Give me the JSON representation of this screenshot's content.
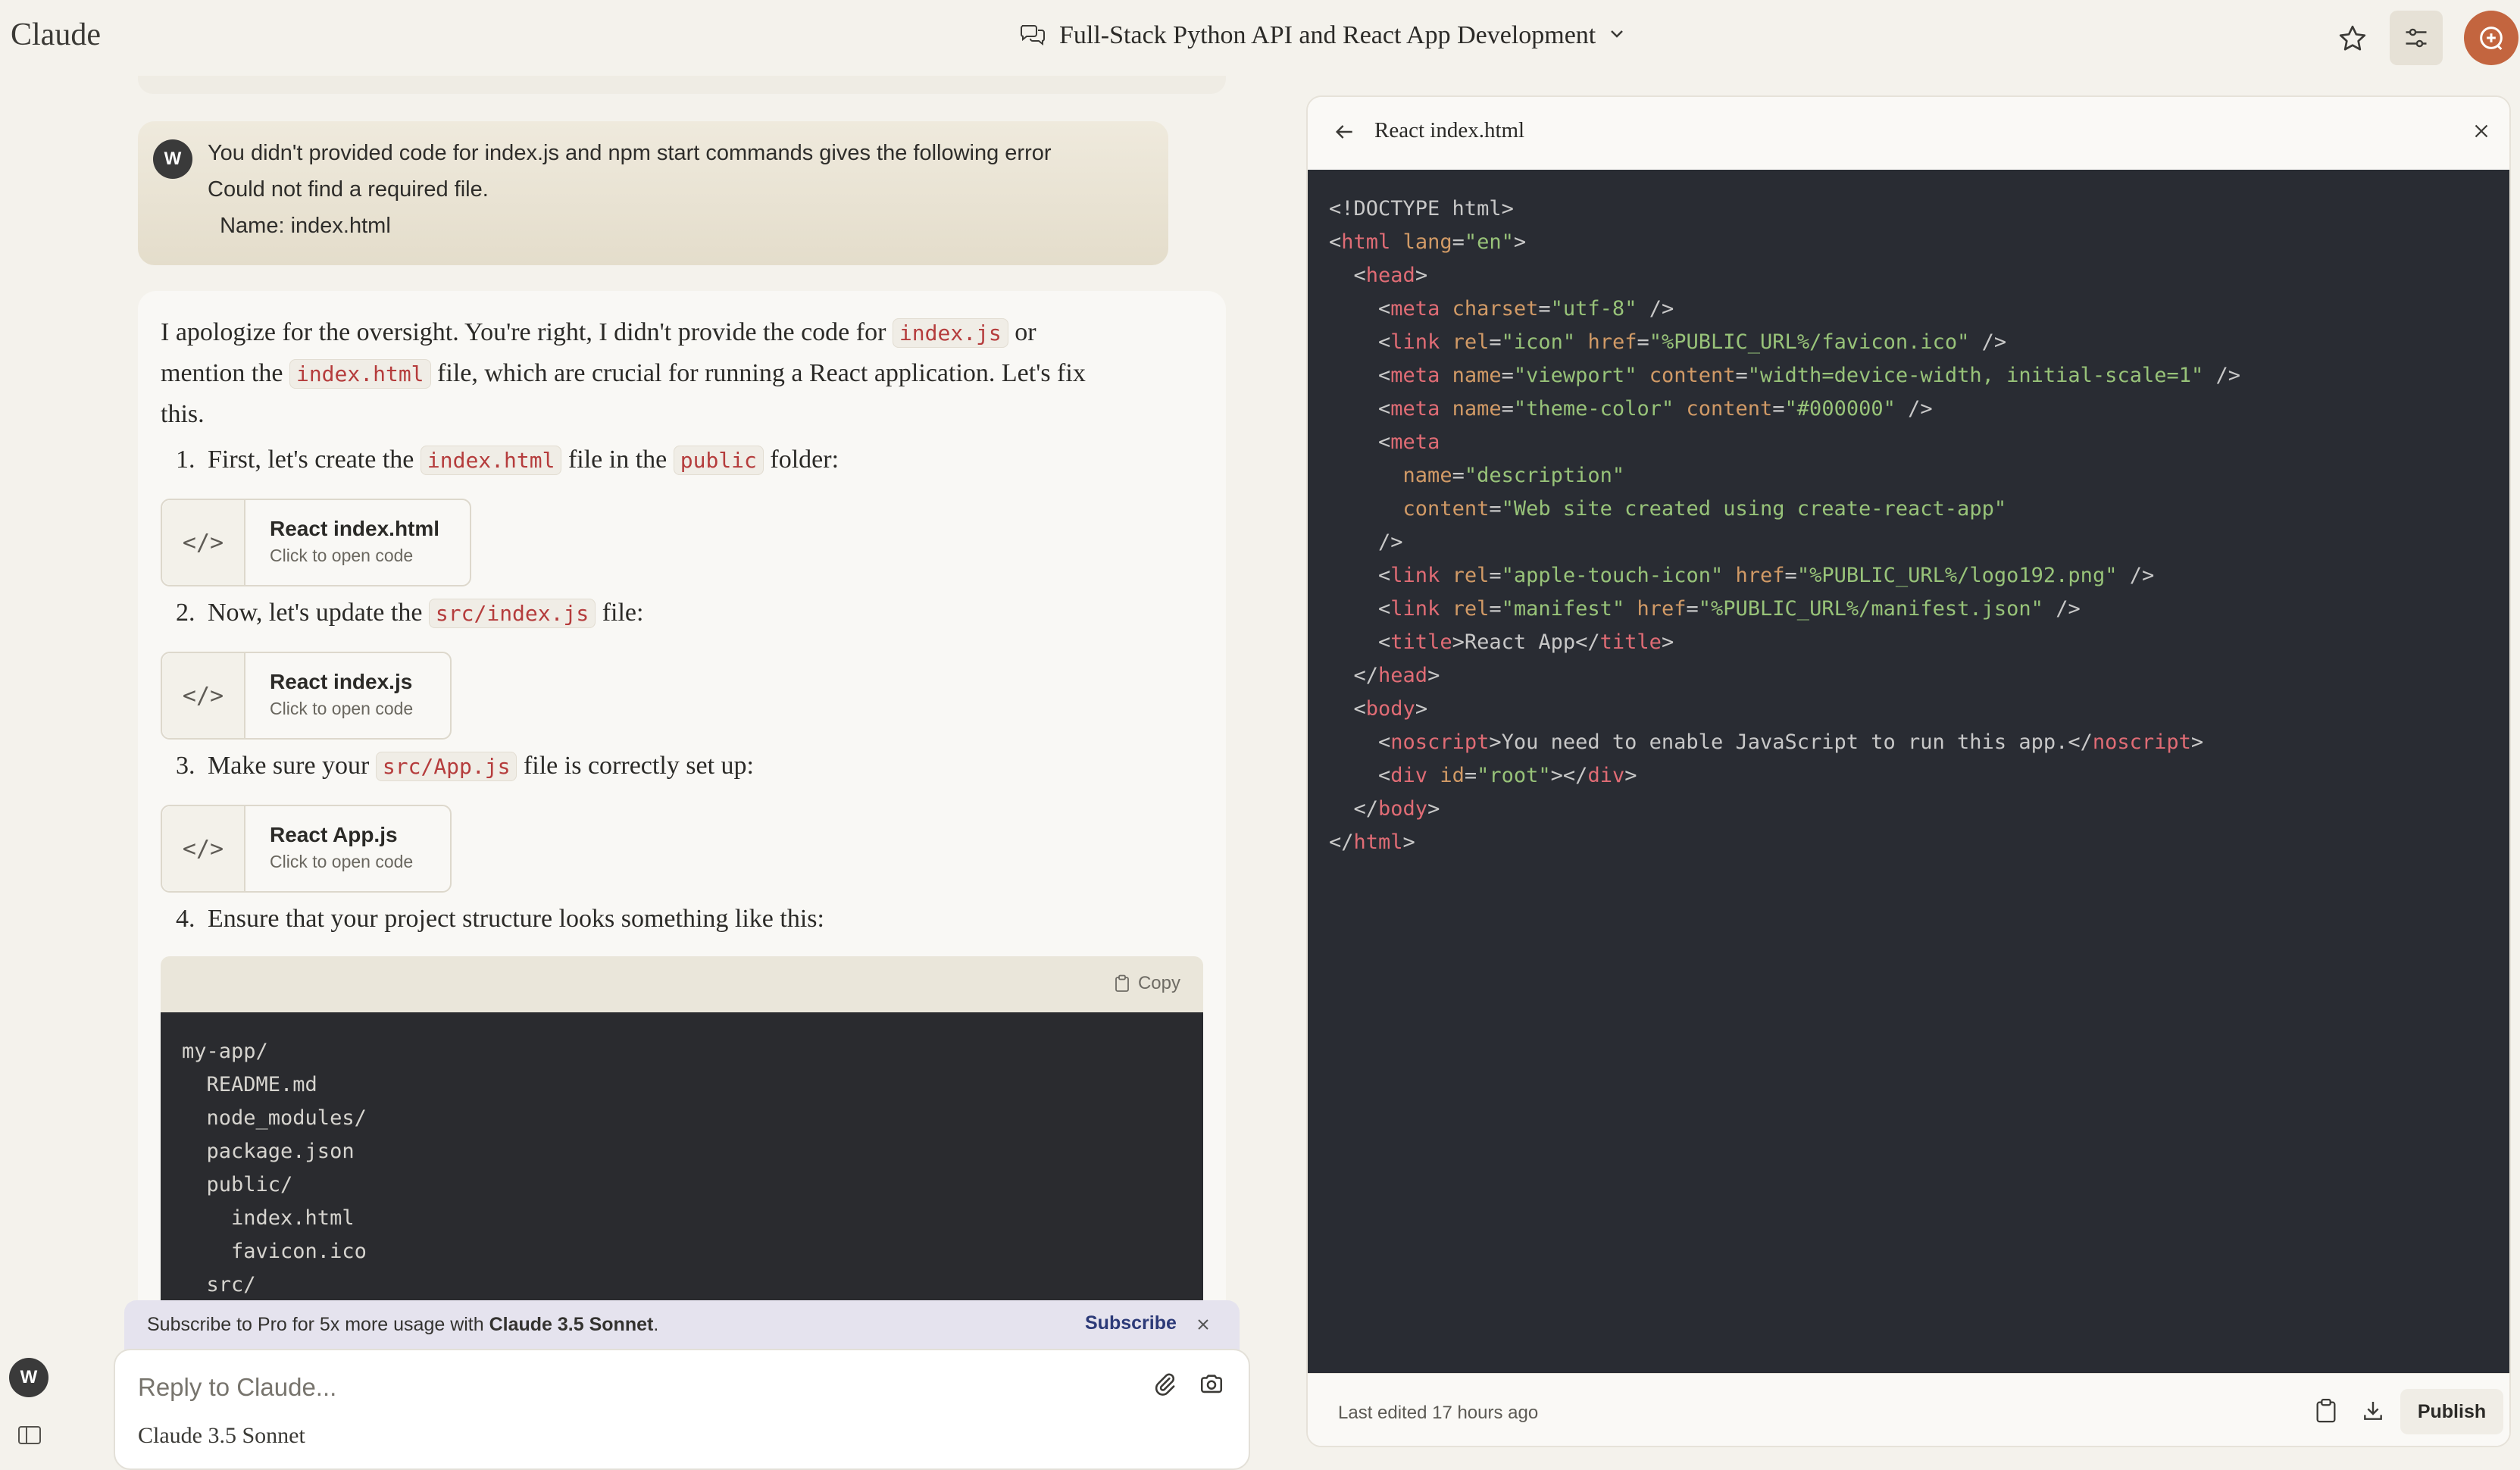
{
  "app": {
    "logo": "Claude"
  },
  "header": {
    "conversation_title": "Full-Stack Python API and React App Development"
  },
  "user_message": {
    "avatar_initial": "W",
    "lines": [
      "You didn't provided code for index.js and npm start commands gives the following error",
      "Could not find a required file.",
      "  Name: index.html"
    ]
  },
  "assistant": {
    "intro": {
      "a": "I apologize for the oversight. You're right, I didn't provide the code for ",
      "code1": "index.js",
      "b": " or",
      "c": "mention the ",
      "code2": "index.html",
      "d": " file, which are crucial for running a React application. Let's fix",
      "e": "this."
    },
    "steps": [
      {
        "num": "1.",
        "pre": "First, let's create the ",
        "code": "index.html",
        "mid": " file in the ",
        "code2": "public",
        "post": " folder:"
      },
      {
        "num": "2.",
        "pre": "Now, let's update the ",
        "code": "src/index.js",
        "post": " file:"
      },
      {
        "num": "3.",
        "pre": "Make sure your ",
        "code": "src/App.js",
        "post": " file is correctly set up:"
      },
      {
        "num": "4.",
        "pre": "Ensure that your project structure looks something like this:"
      }
    ],
    "artifacts": [
      {
        "title": "React index.html",
        "subtitle": "Click to open code"
      },
      {
        "title": "React index.js",
        "subtitle": "Click to open code"
      },
      {
        "title": "React App.js",
        "subtitle": "Click to open code"
      }
    ],
    "copy_label": "Copy",
    "tree": [
      "my-app/",
      "  README.md",
      "  node_modules/",
      "  package.json",
      "  public/",
      "    index.html",
      "    favicon.ico",
      "  src/"
    ]
  },
  "banner": {
    "text_prefix": "Subscribe to Pro for 5x more usage with ",
    "model_name": "Claude 3.5 Sonnet",
    "text_suffix": ".",
    "subscribe_label": "Subscribe"
  },
  "reply": {
    "placeholder": "Reply to Claude...",
    "model": "Claude 3.5 Sonnet"
  },
  "sidebar": {
    "avatar_initial": "W"
  },
  "artifact_panel": {
    "title": "React index.html",
    "last_edited": "Last edited 17 hours ago",
    "publish_label": "Publish",
    "code_lines": [
      "<!DOCTYPE html>",
      "<html lang=\"en\">",
      "  <head>",
      "    <meta charset=\"utf-8\" />",
      "    <link rel=\"icon\" href=\"%PUBLIC_URL%/favicon.ico\" />",
      "    <meta name=\"viewport\" content=\"width=device-width, initial-scale=1\" />",
      "    <meta name=\"theme-color\" content=\"#000000\" />",
      "    <meta",
      "      name=\"description\"",
      "      content=\"Web site created using create-react-app\"",
      "    />",
      "    <link rel=\"apple-touch-icon\" href=\"%PUBLIC_URL%/logo192.png\" />",
      "    <link rel=\"manifest\" href=\"%PUBLIC_URL%/manifest.json\" />",
      "    <title>React App</title>",
      "  </head>",
      "  <body>",
      "    <noscript>You need to enable JavaScript to run this app.</noscript>",
      "    <div id=\"root\"></div>",
      "  </body>",
      "</html>"
    ]
  }
}
